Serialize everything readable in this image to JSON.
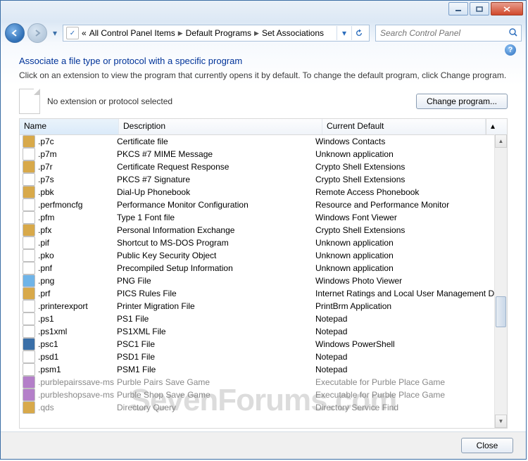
{
  "title_buttons": {
    "min": "minimize",
    "max": "maximize",
    "close": "close"
  },
  "breadcrumb": {
    "prefix": "«",
    "items": [
      "All Control Panel Items",
      "Default Programs",
      "Set Associations"
    ]
  },
  "search": {
    "placeholder": "Search Control Panel"
  },
  "heading": "Associate a file type or protocol with a specific program",
  "subheading": "Click on an extension to view the program that currently opens it by default. To change the default program, click Change program.",
  "selection_text": "No extension or protocol selected",
  "change_btn": "Change program...",
  "columns": {
    "name": "Name",
    "desc": "Description",
    "def": "Current Default"
  },
  "rows": [
    {
      "ext": ".p7c",
      "desc": "Certificate file",
      "def": "Windows Contacts",
      "icon": "#d8a94a",
      "dim": false
    },
    {
      "ext": ".p7m",
      "desc": "PKCS #7 MIME Message",
      "def": "Unknown application",
      "icon": "#ffffff",
      "dim": false
    },
    {
      "ext": ".p7r",
      "desc": "Certificate Request Response",
      "def": "Crypto Shell Extensions",
      "icon": "#d8a94a",
      "dim": false
    },
    {
      "ext": ".p7s",
      "desc": "PKCS #7 Signature",
      "def": "Crypto Shell Extensions",
      "icon": "#ffffff",
      "dim": false
    },
    {
      "ext": ".pbk",
      "desc": "Dial-Up Phonebook",
      "def": "Remote Access Phonebook",
      "icon": "#d8a94a",
      "dim": false
    },
    {
      "ext": ".perfmoncfg",
      "desc": "Performance Monitor Configuration",
      "def": "Resource and Performance Monitor",
      "icon": "#ffffff",
      "dim": false
    },
    {
      "ext": ".pfm",
      "desc": "Type 1 Font file",
      "def": "Windows Font Viewer",
      "icon": "#ffffff",
      "dim": false
    },
    {
      "ext": ".pfx",
      "desc": "Personal Information Exchange",
      "def": "Crypto Shell Extensions",
      "icon": "#d8a94a",
      "dim": false
    },
    {
      "ext": ".pif",
      "desc": "Shortcut to MS-DOS Program",
      "def": "Unknown application",
      "icon": "#ffffff",
      "dim": false
    },
    {
      "ext": ".pko",
      "desc": "Public Key Security Object",
      "def": "Unknown application",
      "icon": "#ffffff",
      "dim": false
    },
    {
      "ext": ".pnf",
      "desc": "Precompiled Setup Information",
      "def": "Unknown application",
      "icon": "#ffffff",
      "dim": false
    },
    {
      "ext": ".png",
      "desc": "PNG File",
      "def": "Windows Photo Viewer",
      "icon": "#6fb4e8",
      "dim": false
    },
    {
      "ext": ".prf",
      "desc": "PICS Rules File",
      "def": "Internet Ratings and Local User Management DLL",
      "icon": "#d8a94a",
      "dim": false
    },
    {
      "ext": ".printerexport",
      "desc": "Printer Migration File",
      "def": "PrintBrm Application",
      "icon": "#ffffff",
      "dim": false
    },
    {
      "ext": ".ps1",
      "desc": "PS1 File",
      "def": "Notepad",
      "icon": "#ffffff",
      "dim": false
    },
    {
      "ext": ".ps1xml",
      "desc": "PS1XML File",
      "def": "Notepad",
      "icon": "#ffffff",
      "dim": false
    },
    {
      "ext": ".psc1",
      "desc": "PSC1 File",
      "def": "Windows PowerShell",
      "icon": "#3a6fa8",
      "dim": false
    },
    {
      "ext": ".psd1",
      "desc": "PSD1 File",
      "def": "Notepad",
      "icon": "#ffffff",
      "dim": false
    },
    {
      "ext": ".psm1",
      "desc": "PSM1 File",
      "def": "Notepad",
      "icon": "#ffffff",
      "dim": false
    },
    {
      "ext": ".purblepairssave-ms",
      "desc": "Purble Pairs Save Game",
      "def": "Executable for Purble Place Game",
      "icon": "#b47fc9",
      "dim": true
    },
    {
      "ext": ".purbleshopsave-ms",
      "desc": "Purble Shop Save Game",
      "def": "Executable for Purble Place Game",
      "icon": "#b47fc9",
      "dim": true
    },
    {
      "ext": ".qds",
      "desc": "Directory Query",
      "def": "Directory Service Find",
      "icon": "#d8a94a",
      "dim": true
    }
  ],
  "close_btn": "Close",
  "watermark": "SevenForums.com"
}
